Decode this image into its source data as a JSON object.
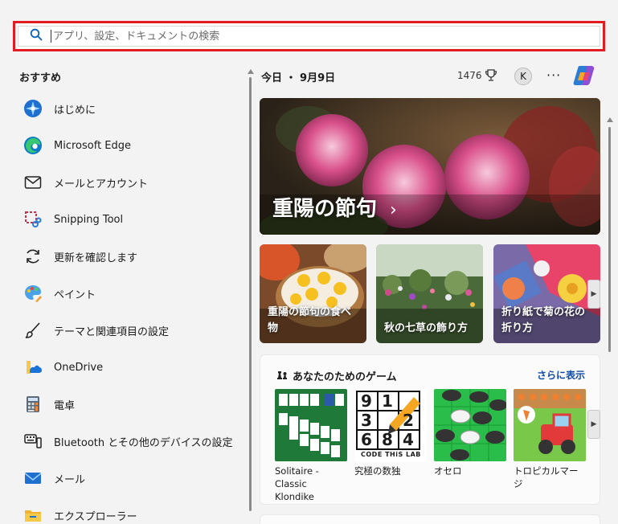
{
  "search": {
    "placeholder": "アプリ、設定、ドキュメントの検索"
  },
  "recommended": {
    "title": "おすすめ",
    "items": [
      {
        "label": "はじめに",
        "icon": "get-started-icon"
      },
      {
        "label": "Microsoft Edge",
        "icon": "edge-icon"
      },
      {
        "label": "メールとアカウント",
        "icon": "mail-outline-icon"
      },
      {
        "label": "Snipping Tool",
        "icon": "snipping-tool-icon"
      },
      {
        "label": "更新を確認します",
        "icon": "refresh-icon"
      },
      {
        "label": "ペイント",
        "icon": "paint-palette-icon"
      },
      {
        "label": "テーマと関連項目の設定",
        "icon": "brush-icon"
      },
      {
        "label": "OneDrive",
        "icon": "onedrive-icon"
      },
      {
        "label": "電卓",
        "icon": "calculator-icon"
      },
      {
        "label": "Bluetooth とその他のデバイスの設定",
        "icon": "devices-icon"
      },
      {
        "label": "メール",
        "icon": "mail-icon"
      },
      {
        "label": "エクスプローラー",
        "icon": "folder-icon"
      }
    ]
  },
  "header": {
    "today": "今日 ・ 9月9日",
    "points": "1476",
    "avatar": "K",
    "more": "···"
  },
  "hero": {
    "title": "重陽の節句",
    "chevron": "›"
  },
  "cards": [
    {
      "label": "重陽の節句の食べ物"
    },
    {
      "label": "秋の七草の飾り方"
    },
    {
      "label": "折り紙で菊の花の折り方"
    }
  ],
  "games": {
    "title": "あなたのためのゲーム",
    "more": "さらに表示",
    "items": [
      {
        "name": "Solitaire - Classic Klondike"
      },
      {
        "name": "究極の数独",
        "logo_text": "CODE THiS LAB",
        "digits": [
          "9",
          "1",
          "",
          "3",
          "",
          "2",
          "6",
          "8",
          "4"
        ]
      },
      {
        "name": "オセロ"
      },
      {
        "name": "トロピカルマージ"
      }
    ]
  },
  "colors": {
    "search_border": "#e31b23",
    "link": "#0e4aa8"
  }
}
